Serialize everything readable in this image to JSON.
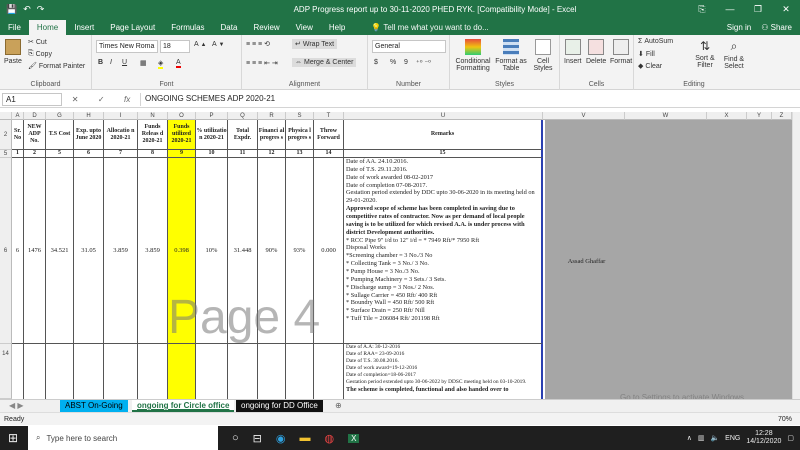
{
  "window": {
    "title": "ADP Progress report up to  30-11-2020 PHED RYK.  [Compatibility Mode] - Excel",
    "controls": [
      "⎘",
      "—",
      "❐",
      "✕"
    ]
  },
  "quick_access": {
    "save": "💾",
    "undo": "↶",
    "redo": "↷"
  },
  "ribbon_tabs": [
    "File",
    "Home",
    "Insert",
    "Page Layout",
    "Formulas",
    "Data",
    "Review",
    "View",
    "Help"
  ],
  "tell_me": "Tell me what you want to do...",
  "account": {
    "sign_in": "Sign in",
    "share": "Share"
  },
  "clipboard": {
    "paste": "Paste",
    "cut": "Cut",
    "copy": "Copy",
    "format_painter": "Format Painter",
    "label": "Clipboard"
  },
  "font": {
    "name": "Times New Roma",
    "size": "18",
    "bold": "B",
    "italic": "I",
    "underline": "U",
    "label": "Font"
  },
  "alignment": {
    "wrap": "Wrap Text",
    "merge": "Merge & Center",
    "label": "Alignment"
  },
  "number": {
    "format": "General",
    "currency": "$",
    "percent": "%",
    "comma": "9",
    "label": "Number"
  },
  "styles": {
    "conditional": "Conditional Formatting",
    "table": "Format as Table",
    "cell": "Cell Styles",
    "label": "Styles"
  },
  "cells": {
    "insert": "Insert",
    "delete": "Delete",
    "format": "Format",
    "label": "Cells"
  },
  "editing": {
    "autosum": "AutoSum",
    "fill": "Fill",
    "clear": "Clear",
    "sort": "Sort & Filter",
    "find": "Find & Select",
    "label": "Editing"
  },
  "formula_bar": {
    "name_box": "A1",
    "cancel": "✕",
    "enter": "✓",
    "fx": "fx",
    "content": "ONGOING SCHEMES ADP 2020-21"
  },
  "columns": [
    "A",
    "D",
    "G",
    "H",
    "I",
    "N",
    "O",
    "P",
    "Q",
    "R",
    "S",
    "T",
    "U",
    "V",
    "W",
    "X",
    "Y",
    "Z"
  ],
  "row_numbers": [
    "2",
    "3",
    "5",
    "6",
    "14"
  ],
  "table_headers": {
    "sr": "Sr. No",
    "adp": "NEW ADP No.",
    "ts": "T.S Cost",
    "exp": "Exp. upto June 2020",
    "alloc": "Allocatio n 2020-21",
    "funds_rel": "Funds Releas d 2020-21",
    "funds_util": "Funds utilized 2020-21",
    "pct_util": "% utilizatio n 2020-21",
    "total": "Total Expdr.",
    "fin": "Financi al progres s",
    "phy": "Physica l progres s",
    "throw": "Throw Forward",
    "remarks": "Remarks"
  },
  "col_numbers": [
    "1",
    "2",
    "5",
    "6",
    "7",
    "8",
    "9",
    "10",
    "11",
    "12",
    "13",
    "14",
    "15"
  ],
  "row6": {
    "sr": "6",
    "adp": "1476",
    "ts": "34.521",
    "exp": "31.05",
    "alloc": "3.859",
    "funds_rel": "3.859",
    "funds_util": "0.398",
    "pct_util": "10%",
    "total": "31.448",
    "fin": "90%",
    "phy": "93%",
    "throw": "0.000",
    "officer": "Assad Ghaffar"
  },
  "remarks_lines": [
    "Date of AA. 24.10.2016.",
    "Date of T.S. 29.11.2016.",
    "Date of work awarded 08-02-2017",
    "Date of completion 07-08-2017.",
    "Gestation period extended by DDC upto 30-06-2020 in its meeting held on 29-01-2020."
  ],
  "remarks_bold": "Approved scope of scheme has been completed in saving due to competitive rates of contractor. Now as per demand of local people saving is to be utilized for which revised A.A. is under process with district Development authorities.",
  "remarks_items": [
    "* RCC Pipe 9\" i/d to 12\" i/d = * 7949 Rft/* 7950 Rft",
    "Disposal Works",
    "*Screening chamber = 3 No./3 No",
    "* Collecting Tank = 3 No./ 3 No.",
    "* Pump House = 3 No./3 No.",
    "* Pumping Machinery = 3 Sets./ 3 Sets.",
    "* Discharge sump = 3 Nos./ 2 Nos.",
    "* Sullage Carrier = 450 Rft/ 400 Rft",
    "* Boundry Wall = 450 Rft/ 500 Rft",
    "* Surface Drain = 250 Rft/ Nill",
    "* Tuff Tile = 206084 Rft/ 201198 Rft"
  ],
  "remarks_next": [
    "Date of A.A: 30-12-2016",
    "Date of RAA= 23-09-2016",
    "Date of T.S. 30.08.2016.",
    "Date of work award=19-12-2016",
    "Date of completion=18-06-2017",
    "Gestation period extended upto 30-06-2022 by DDSC meeting held on 03-10-2019.",
    "The scheme is completed, functional and also handed over to"
  ],
  "watermark": "Page 4",
  "sheet_tabs": [
    "ABST On-Going",
    "ongoing for Circle office",
    "ongoing for DD Office"
  ],
  "status": {
    "ready": "Ready",
    "zoom": "70%"
  },
  "activate_windows": "Go to Settings to activate Windows.",
  "taskbar": {
    "search": "Type here to search",
    "lang": "ENG",
    "time": "12:28",
    "date": "14/12/2020"
  }
}
